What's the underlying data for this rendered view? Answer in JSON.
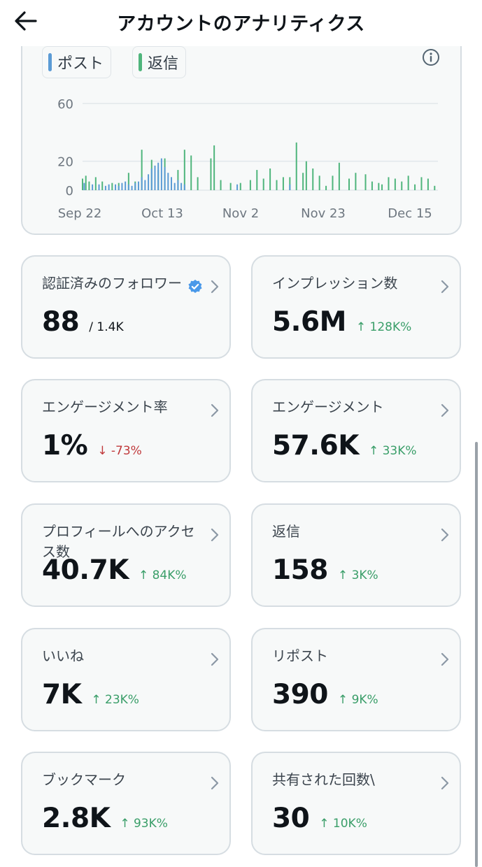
{
  "header": {
    "title": "アカウントのアナリティクス"
  },
  "legend": [
    {
      "label": "ポスト",
      "color": "#5b9bd5"
    },
    {
      "label": "返信",
      "color": "#4fb57c"
    }
  ],
  "chart_data": {
    "type": "bar",
    "y_ticks": [
      "60",
      "20",
      "0"
    ],
    "x_ticks": [
      "Sep 22",
      "Oct 13",
      "Nov 2",
      "Nov 23",
      "Dec 15"
    ],
    "ylim": [
      0,
      60
    ],
    "series": [
      {
        "name": "ポスト",
        "color": "#5b9bd5",
        "x": [
          0.5,
          3,
          5,
          7,
          8,
          10,
          11,
          12,
          13,
          14,
          15,
          16,
          17,
          18,
          19,
          20,
          21,
          22,
          23,
          24,
          25,
          26,
          27,
          28,
          29,
          30,
          31,
          47,
          63
        ],
        "values": [
          5,
          4,
          4,
          3,
          4,
          4,
          3,
          5,
          6,
          4,
          3,
          5,
          6,
          9,
          7,
          11,
          15,
          17,
          19,
          22,
          16,
          12,
          9,
          5,
          7,
          5,
          4,
          4,
          4
        ]
      },
      {
        "name": "返信",
        "color": "#4fb57c",
        "x": [
          0,
          1,
          2,
          4,
          6,
          9,
          11,
          14,
          16,
          18,
          21,
          23,
          25,
          27,
          29,
          31,
          33,
          35,
          39,
          40,
          42,
          45,
          48,
          51,
          53,
          55,
          57,
          59,
          61,
          63,
          65,
          67,
          68,
          70,
          72,
          74,
          76,
          78,
          81,
          83,
          86,
          88,
          90,
          91,
          93,
          95,
          97,
          99,
          101,
          103,
          105,
          107
        ],
        "values": [
          8,
          10,
          6,
          9,
          6,
          5,
          5,
          12,
          6,
          28,
          21,
          14,
          22,
          9,
          14,
          28,
          24,
          9,
          22,
          31,
          7,
          5,
          5,
          7,
          14,
          8,
          15,
          7,
          9,
          9,
          33,
          12,
          20,
          15,
          10,
          3,
          10,
          19,
          8,
          12,
          11,
          6,
          5,
          4,
          9,
          8,
          6,
          10,
          4,
          9,
          8,
          3
        ]
      }
    ]
  },
  "metrics": [
    {
      "label": "認証済みのフォロワー",
      "value": "88",
      "sub": "/ 1.4K",
      "change": "",
      "direction": ""
    },
    {
      "label": "インプレッション数",
      "value": "5.6M",
      "sub": "",
      "change": "↑ 128K%",
      "direction": "up"
    },
    {
      "label": "エンゲージメント率",
      "value": "1%",
      "sub": "",
      "change": "↓ -73%",
      "direction": "down"
    },
    {
      "label": "エンゲージメント",
      "value": "57.6K",
      "sub": "",
      "change": "↑ 33K%",
      "direction": "up"
    },
    {
      "label": "プロフィールへのアクセス数",
      "value": "40.7K",
      "sub": "",
      "change": "↑ 84K%",
      "direction": "up"
    },
    {
      "label": "返信",
      "value": "158",
      "sub": "",
      "change": "↑ 3K%",
      "direction": "up"
    },
    {
      "label": "いいね",
      "value": "7K",
      "sub": "",
      "change": "↑ 23K%",
      "direction": "up"
    },
    {
      "label": "リポスト",
      "value": "390",
      "sub": "",
      "change": "↑ 9K%",
      "direction": "up"
    },
    {
      "label": "ブックマーク",
      "value": "2.8K",
      "sub": "",
      "change": "↑ 93K%",
      "direction": "up"
    },
    {
      "label": "共有された回数\\",
      "value": "30",
      "sub": "",
      "change": "↑ 10K%",
      "direction": "up"
    }
  ],
  "icons": {
    "back": "arrow-left-icon",
    "info": "info-icon",
    "chevron": "chevron-right-icon",
    "verified": "verified-badge-icon"
  }
}
